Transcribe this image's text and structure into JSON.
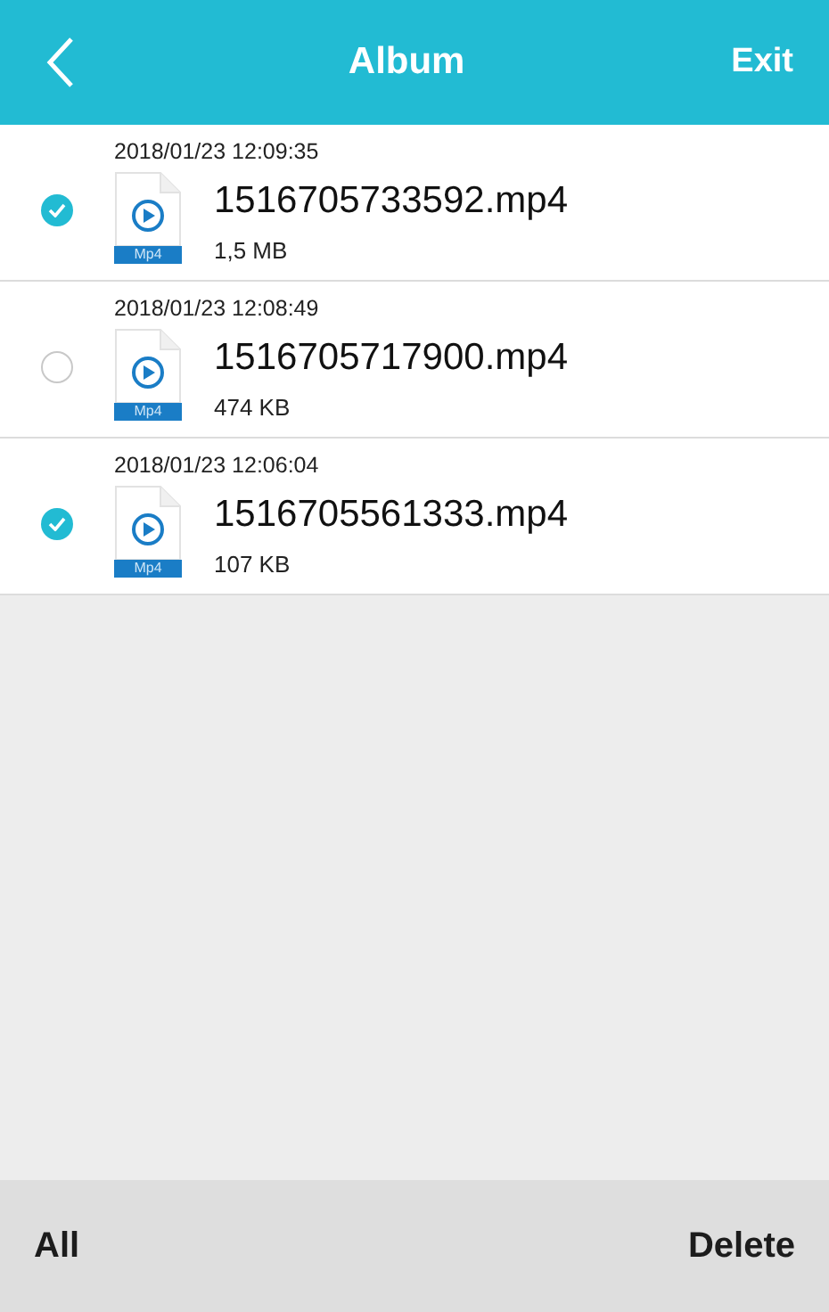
{
  "header": {
    "title": "Album",
    "action": "Exit"
  },
  "files": [
    {
      "date": "2018/01/23 12:09:35",
      "name": "1516705733592.mp4",
      "size": "1,5 MB",
      "badge": "Mp4",
      "selected": true
    },
    {
      "date": "2018/01/23 12:08:49",
      "name": "1516705717900.mp4",
      "size": "474 KB",
      "badge": "Mp4",
      "selected": false
    },
    {
      "date": "2018/01/23 12:06:04",
      "name": "1516705561333.mp4",
      "size": "107 KB",
      "badge": "Mp4",
      "selected": true
    }
  ],
  "footer": {
    "select_all": "All",
    "delete": "Delete"
  }
}
